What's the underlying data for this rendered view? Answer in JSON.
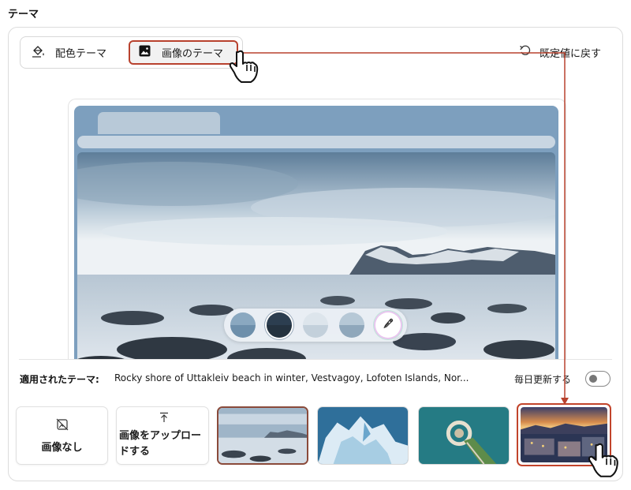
{
  "section_title": "テーマ",
  "tabs": {
    "color_label": "配色テーマ",
    "image_label": "画像のテーマ",
    "selected": "image"
  },
  "reset_label": "既定値に戻す",
  "applied": {
    "label": "適用されたテーマ:",
    "value": "Rocky shore of Uttakleiv beach in winter, Vestvagoy, Lofoten Islands, Nor..."
  },
  "daily_update": {
    "label": "毎日更新する",
    "enabled": false
  },
  "tiles": {
    "no_image_label": "画像なし",
    "upload_line1": "画像をアップロー",
    "upload_line2": "ドする"
  },
  "swatches": [
    {
      "name": "swatch-1",
      "top": "#8aa8c0",
      "bottom": "#6d8fab",
      "selected": false
    },
    {
      "name": "swatch-2",
      "top": "#2c3e50",
      "bottom": "#2c3e50",
      "selected": true
    },
    {
      "name": "swatch-3",
      "top": "#dde5ec",
      "bottom": "#c3d0db",
      "selected": false
    },
    {
      "name": "swatch-4",
      "top": "#b6c8d6",
      "bottom": "#8fa7bb",
      "selected": false
    }
  ],
  "colors": {
    "accent": "#b8422e",
    "frame": "#7d9fbe"
  },
  "icons": [
    "paint-bucket-icon",
    "image-icon",
    "undo-icon",
    "no-image-icon",
    "upload-icon",
    "eyedropper-icon",
    "hand-cursor-icon"
  ]
}
